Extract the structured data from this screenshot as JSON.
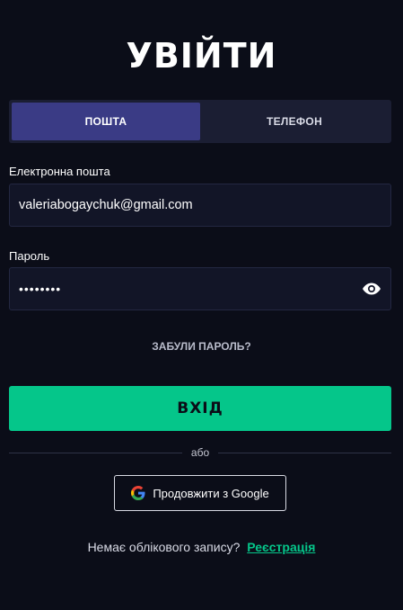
{
  "title": "УВІЙТИ",
  "tabs": [
    {
      "label": "ПОШТА",
      "active": true
    },
    {
      "label": "ТЕЛЕФОН",
      "active": false
    }
  ],
  "email": {
    "label": "Електронна пошта",
    "value": "valeriabogaychuk@gmail.com"
  },
  "password": {
    "label": "Пароль",
    "masked_value": "••••••••",
    "toggle_icon": "eye-icon"
  },
  "forgot_label": "ЗАБУЛИ ПАРОЛЬ?",
  "login_label": "ВХІД",
  "divider_label": "або",
  "google": {
    "label": "Продовжити з Google",
    "icon": "google-icon"
  },
  "signup": {
    "prompt": "Немає облікового запису?",
    "link": "Реєстрація"
  },
  "colors": {
    "background": "#0b0d18",
    "accent": "#05c68a",
    "active_tab": "#3a3b85"
  }
}
